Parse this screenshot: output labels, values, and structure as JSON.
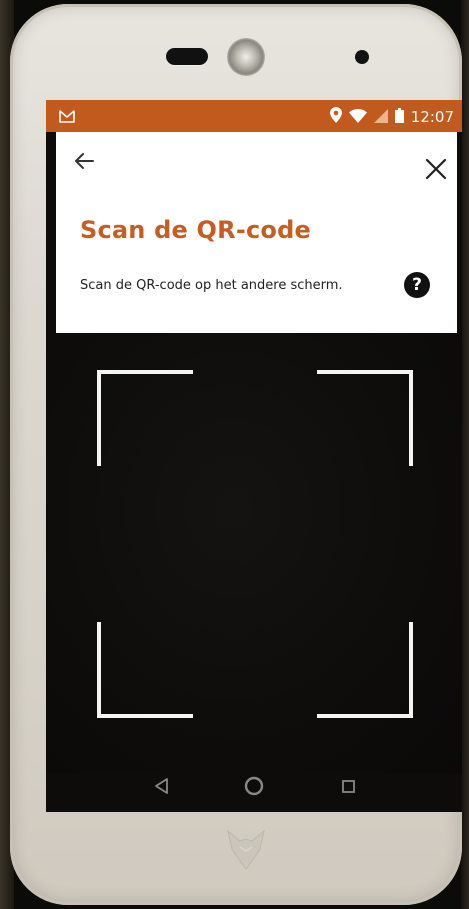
{
  "status_bar": {
    "time": "12:07",
    "left_icon": "gmail-icon",
    "right_icons": [
      "location-icon",
      "wifi-icon",
      "signal-icon",
      "battery-icon"
    ],
    "background_color": "#c35a1d"
  },
  "header": {
    "back_icon": "arrow-left-icon",
    "close_icon": "close-icon",
    "title": "Scan de QR-code",
    "subtitle": "Scan de QR-code op het andere scherm.",
    "help_label": "?",
    "title_color": "#c65e23"
  },
  "scanner": {
    "frame_icon": "qr-scan-frame"
  },
  "nav_bar": {
    "back_icon": "nav-back-icon",
    "home_icon": "nav-home-icon",
    "recents_icon": "nav-recents-icon"
  }
}
